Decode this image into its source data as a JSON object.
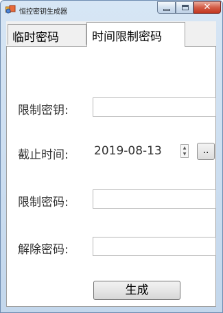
{
  "window": {
    "title": "恒控密钥生成器",
    "close_glyph": "✕"
  },
  "tabs": [
    {
      "label": "临时密码",
      "selected": false
    },
    {
      "label": "时间限制密码",
      "selected": true
    }
  ],
  "form": {
    "limit_key_label": "限制密钥:",
    "limit_key_value": "",
    "deadline_label": "截止时间:",
    "deadline_value": "2019-08-13",
    "date_picker_label": "..",
    "limit_password_label": "限制密码:",
    "limit_password_value": "",
    "unlock_password_label": "解除密码:",
    "unlock_password_value": "",
    "generate_label": "生成"
  },
  "icons": {
    "app": "app-icon",
    "spinner_up": "▲",
    "spinner_down": "▼"
  },
  "colors": {
    "titlebar": "#c9dcef",
    "close_button": "#c9412b",
    "panel": "#ffffff",
    "client": "#f0f0f0"
  }
}
